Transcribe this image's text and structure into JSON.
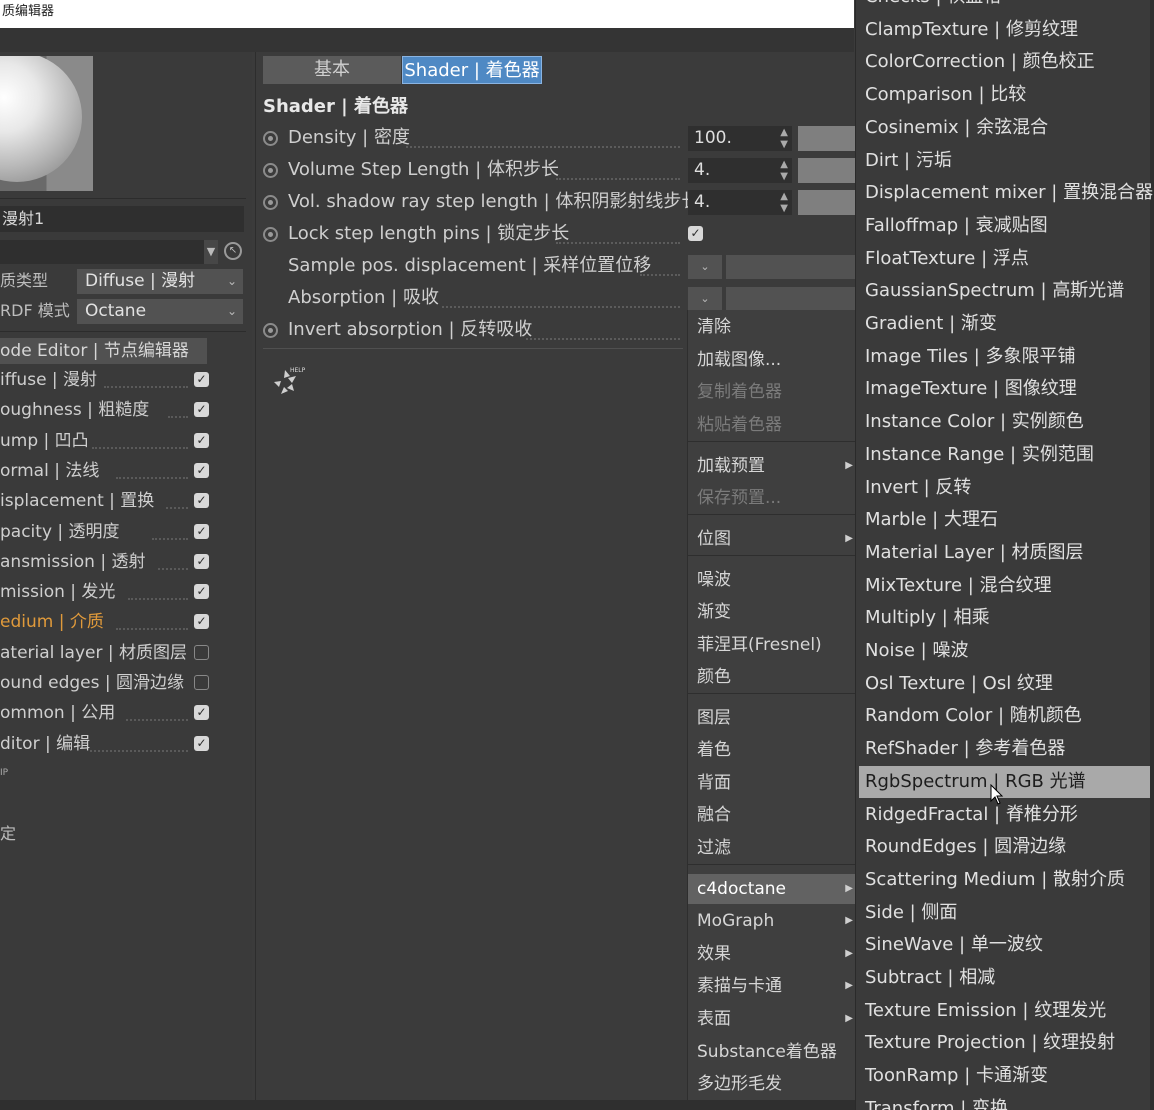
{
  "window": {
    "title": "质编辑器"
  },
  "left": {
    "name_value": "漫射1",
    "type_label": "质类型",
    "type_value": "Diffuse | 漫射",
    "brdf_label": "RDF 模式",
    "brdf_value": "Octane",
    "node_editor_label": "ode Editor | 节点编辑器",
    "channels": [
      {
        "label": "iffuse | 漫射",
        "checked": true
      },
      {
        "label": "oughness | 粗糙度",
        "checked": true
      },
      {
        "label": "ump | 凹凸",
        "checked": true
      },
      {
        "label": "ormal | 法线",
        "checked": true
      },
      {
        "label": "isplacement | 置换",
        "checked": true
      },
      {
        "label": "pacity | 透明度",
        "checked": true
      },
      {
        "label": "ansmission | 透射",
        "checked": true
      },
      {
        "label": "mission | 发光",
        "checked": true
      },
      {
        "label": "edium | 介质",
        "checked": true,
        "active": true
      },
      {
        "label": "aterial layer | 材质图层",
        "checked": false
      },
      {
        "label": "ound edges | 圆滑边缘",
        "checked": false
      },
      {
        "label": "ommon | 公用",
        "checked": true
      },
      {
        "label": "ditor | 编辑",
        "checked": true
      }
    ],
    "tiny_a": "IP",
    "tiny_b": "定"
  },
  "center": {
    "tabs": [
      "基本",
      "Shader | 着色器"
    ],
    "section_title": "Shader | 着色器",
    "props": [
      {
        "label": "Density | 密度",
        "value": "100."
      },
      {
        "label": "Volume Step Length | 体积步长",
        "value": "4."
      },
      {
        "label": "Vol. shadow ray step length | 体积阴影射线步长",
        "value": "4."
      },
      {
        "label": "Lock step length pins | 锁定步长",
        "checked": true
      },
      {
        "label": "Sample pos. displacement | 采样位置位移"
      },
      {
        "label": "Absorption | 吸收"
      },
      {
        "label": "Invert absorption | 反转吸收"
      }
    ],
    "help_label": "HELP"
  },
  "context_menu": {
    "items": [
      {
        "label": "清除"
      },
      {
        "label": "加载图像..."
      },
      {
        "label": "复制着色器",
        "disabled": true
      },
      {
        "label": "粘贴着色器",
        "disabled": true
      },
      {
        "label": "加载预置",
        "submenu": true
      },
      {
        "label": "保存预置...",
        "disabled": true
      },
      {
        "label": "位图",
        "submenu": true
      },
      {
        "label": "噪波"
      },
      {
        "label": "渐变"
      },
      {
        "label": "菲涅耳(Fresnel)"
      },
      {
        "label": "颜色"
      },
      {
        "label": "图层"
      },
      {
        "label": "着色"
      },
      {
        "label": "背面"
      },
      {
        "label": "融合"
      },
      {
        "label": "过滤"
      },
      {
        "label": "c4doctane",
        "submenu": true,
        "selected": true
      },
      {
        "label": "MoGraph",
        "submenu": true
      },
      {
        "label": "效果",
        "submenu": true
      },
      {
        "label": "素描与卡通",
        "submenu": true
      },
      {
        "label": "表面",
        "submenu": true
      },
      {
        "label": "Substance着色器"
      },
      {
        "label": "多边形毛发"
      }
    ]
  },
  "submenu": {
    "items": [
      "Checks | 棋盘格",
      "ClampTexture | 修剪纹理",
      "ColorCorrection | 颜色校正",
      "Comparison | 比较",
      "Cosinemix | 余弦混合",
      "Dirt | 污垢",
      "Displacement mixer | 置换混合器",
      "Falloffmap | 衰减贴图",
      "FloatTexture | 浮点",
      "GaussianSpectrum | 高斯光谱",
      "Gradient | 渐变",
      "Image Tiles | 多象限平铺",
      "ImageTexture | 图像纹理",
      "Instance Color | 实例颜色",
      "Instance Range | 实例范围",
      "Invert | 反转",
      "Marble | 大理石",
      "Material Layer | 材质图层",
      "MixTexture | 混合纹理",
      "Multiply | 相乘",
      "Noise | 噪波",
      "Osl Texture | Osl 纹理",
      "Random Color | 随机颜色",
      "RefShader | 参考着色器",
      "RgbSpectrum | RGB 光谱",
      "RidgedFractal | 脊椎分形",
      "RoundEdges | 圆滑边缘",
      "Scattering Medium | 散射介质",
      "Side | 侧面",
      "SineWave | 单一波纹",
      "Subtract | 相减",
      "Texture Emission | 纹理发光",
      "Texture Projection | 纹理投射",
      "ToonRamp | 卡通渐变",
      "Transform | 变换"
    ],
    "highlighted_index": 24
  },
  "colors": {
    "accent": "#4f89c4",
    "active_channel": "#e09a3b",
    "highlight": "#a9a9a9"
  }
}
